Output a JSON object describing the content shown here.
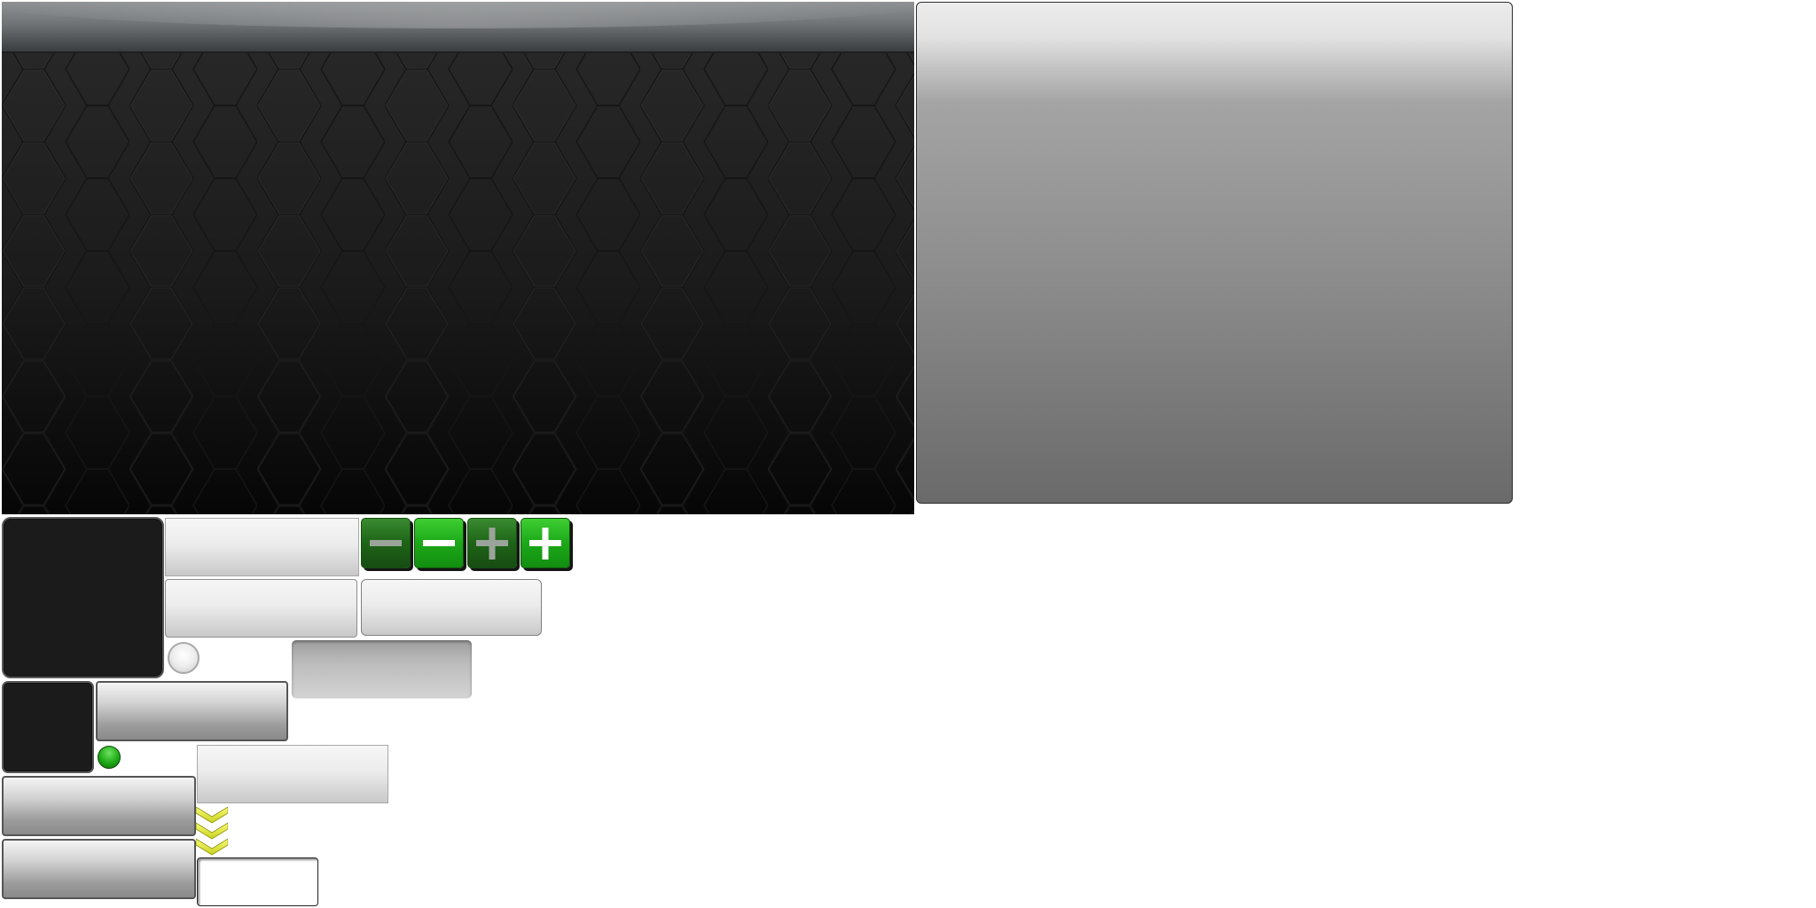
{
  "icons": {
    "minus_dark": "minus-icon",
    "minus_light": "minus-icon",
    "plus_dark": "plus-icon",
    "plus_light": "plus-icon",
    "chevrons": "chevron-down-triple-icon"
  },
  "colors": {
    "green_dark": "#1e6417",
    "green_light": "#1ca818",
    "chevron_yellow": "#e6ee3a",
    "panel_dark": "#1b1b1b",
    "panel_silver": "#8c8c8c"
  },
  "radio_on_selected": true,
  "radio_off_selected": false
}
